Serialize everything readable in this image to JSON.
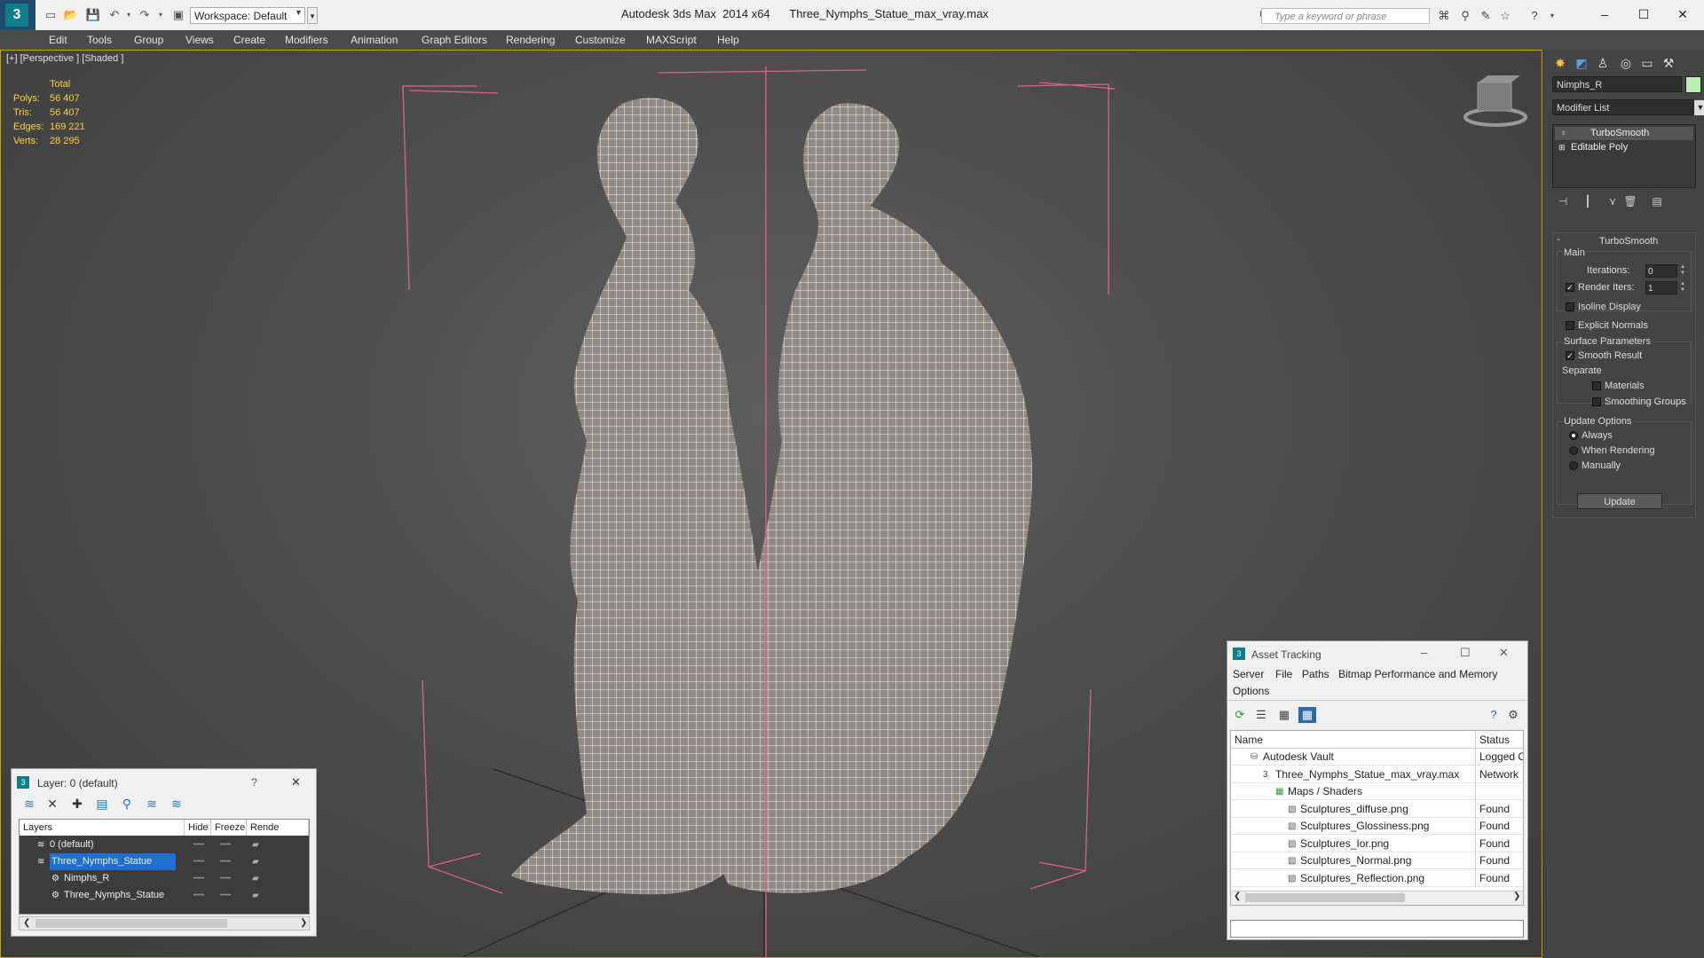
{
  "titlebar": {
    "workspace_label": "Workspace: Default",
    "title_app": "Autodesk 3ds Max  2014 x64",
    "title_file": "Three_Nymphs_Statue_max_vray.max",
    "search_placeholder": "Type a keyword or phrase",
    "logo": "3ds-max-logo",
    "min_glyph": "–",
    "max_glyph": "☐",
    "close_glyph": "✕"
  },
  "menus": [
    "Edit",
    "Tools",
    "Group",
    "Views",
    "Create",
    "Modifiers",
    "Animation",
    "Graph Editors",
    "Rendering",
    "Customize",
    "MAXScript",
    "Help"
  ],
  "viewport": {
    "label": "[+] [Perspective ] [Shaded ]",
    "stats": {
      "header": "Total",
      "polys_label": "Polys:",
      "polys": "56 407",
      "tris_label": "Tris:",
      "tris": "56 407",
      "edges_label": "Edges:",
      "edges": "169 221",
      "verts_label": "Verts:",
      "verts": "28 295"
    },
    "colors": {
      "border": "#c5a700",
      "stats": "#ffd23f",
      "bbox": "#e0608a",
      "wire": "#f2efe8"
    }
  },
  "command_panel": {
    "object_name": "Nimphs_R",
    "modifier_list": "Modifier List",
    "stack": [
      "TurboSmooth",
      "Editable Poly"
    ],
    "rollout_title": "TurboSmooth",
    "main_group": "Main",
    "iterations_label": "Iterations:",
    "iterations_value": "0",
    "render_iters_label": "Render Iters:",
    "render_iters_value": "1",
    "isoline_label": "Isoline Display",
    "explicit_normals_label": "Explicit Normals",
    "surface_group": "Surface Parameters",
    "smooth_result_label": "Smooth Result",
    "separate_label": "Separate",
    "materials_label": "Materials",
    "smoothing_groups_label": "Smoothing Groups",
    "update_group": "Update Options",
    "always_label": "Always",
    "when_rendering_label": "When Rendering",
    "manually_label": "Manually",
    "update_button": "Update"
  },
  "layer_window": {
    "title": "Layer: 0 (default)",
    "help": "?",
    "close": "✕",
    "columns": [
      "Layers",
      "Hide",
      "Freeze",
      "Rende"
    ],
    "rows": [
      {
        "name": "0 (default)",
        "selected": false,
        "indent": 1
      },
      {
        "name": "Three_Nymphs_Statue",
        "selected": true,
        "indent": 1
      },
      {
        "name": "Nimphs_R",
        "selected": false,
        "indent": 2
      },
      {
        "name": "Three_Nymphs_Statue",
        "selected": false,
        "indent": 2
      }
    ]
  },
  "asset_window": {
    "title": "Asset Tracking",
    "menus": [
      "Server",
      "File",
      "Paths",
      "Bitmap Performance and Memory",
      "Options"
    ],
    "columns": [
      "Name",
      "Status"
    ],
    "rows": [
      {
        "name": "Autodesk Vault",
        "status": "Logged O",
        "indent": 1
      },
      {
        "name": "Three_Nymphs_Statue_max_vray.max",
        "status": "Network",
        "indent": 2
      },
      {
        "name": "Maps / Shaders",
        "status": "",
        "indent": 3
      },
      {
        "name": "Sculptures_diffuse.png",
        "status": "Found",
        "indent": 4
      },
      {
        "name": "Sculptures_Glossiness.png",
        "status": "Found",
        "indent": 4
      },
      {
        "name": "Sculptures_Ior.png",
        "status": "Found",
        "indent": 4
      },
      {
        "name": "Sculptures_Normal.png",
        "status": "Found",
        "indent": 4
      },
      {
        "name": "Sculptures_Reflection.png",
        "status": "Found",
        "indent": 4
      }
    ]
  }
}
